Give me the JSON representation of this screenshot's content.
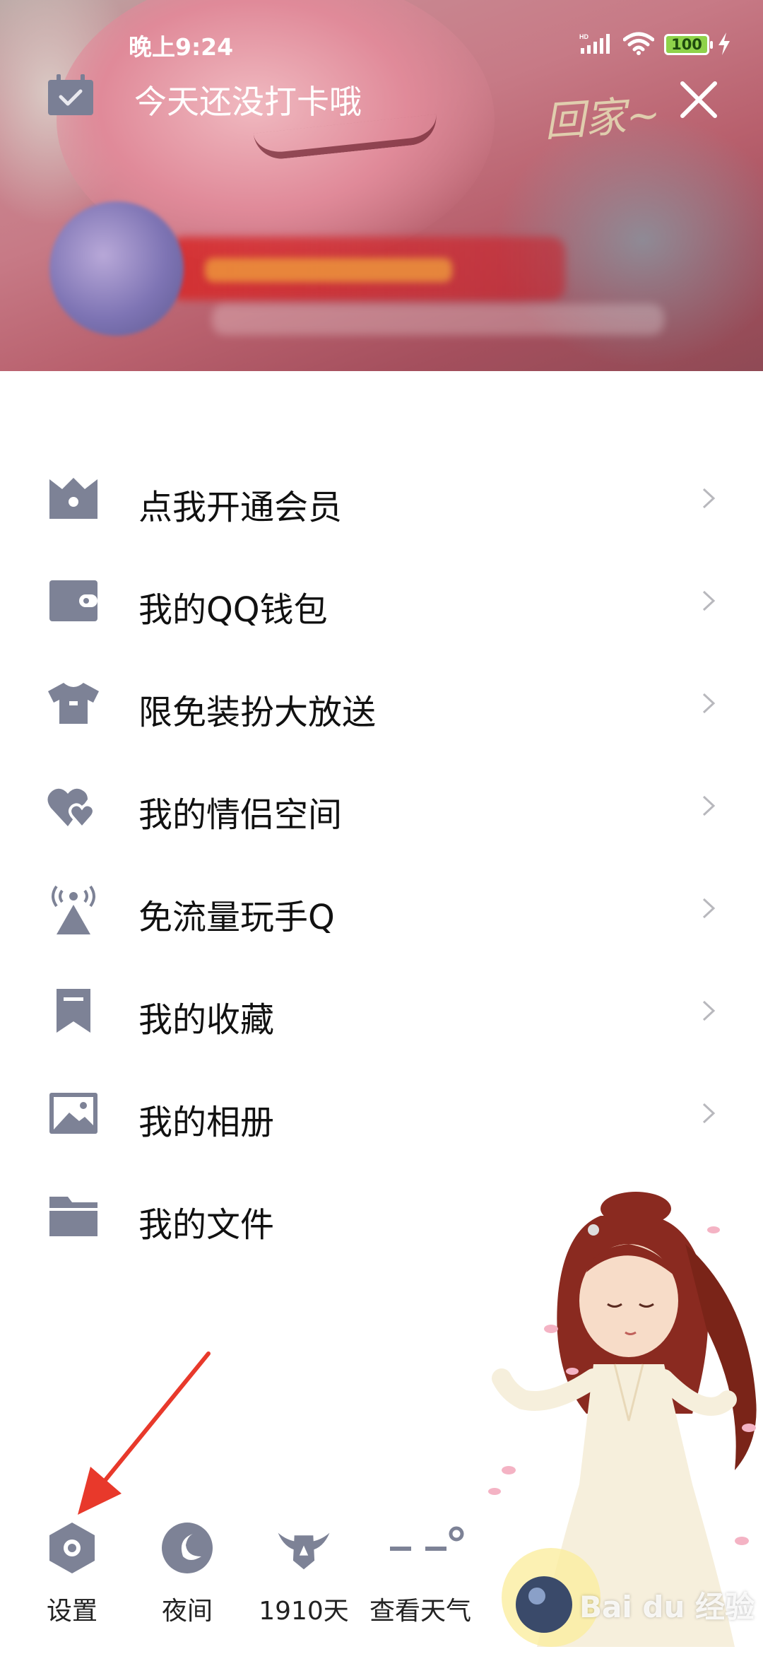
{
  "status_bar": {
    "time": "晚上9:24",
    "battery": "100",
    "network": "HD"
  },
  "header": {
    "checkin_text": "今天还没打卡哦",
    "handwriting": "回家~"
  },
  "menu": {
    "items": [
      {
        "label": "点我开通会员",
        "icon": "crown-icon"
      },
      {
        "label": "我的QQ钱包",
        "icon": "wallet-icon"
      },
      {
        "label": "限免装扮大放送",
        "icon": "tshirt-icon"
      },
      {
        "label": "我的情侣空间",
        "icon": "hearts-icon"
      },
      {
        "label": "免流量玩手Q",
        "icon": "signal-tower-icon"
      },
      {
        "label": "我的收藏",
        "icon": "bookmark-icon"
      },
      {
        "label": "我的相册",
        "icon": "photo-icon"
      },
      {
        "label": "我的文件",
        "icon": "folder-icon"
      }
    ]
  },
  "bottom_bar": {
    "items": [
      {
        "label": "设置",
        "icon": "settings-hexagon-icon"
      },
      {
        "label": "夜间",
        "icon": "moon-icon"
      },
      {
        "label": "1910天",
        "icon": "winged-badge-icon"
      },
      {
        "label": "查看天气",
        "icon": "weather-dashes-icon"
      }
    ]
  },
  "watermark": "Bai du 经验",
  "colors": {
    "icon_gray": "#7d8296",
    "arrow_red": "#e8392b",
    "chevron": "#b8b8bd"
  }
}
